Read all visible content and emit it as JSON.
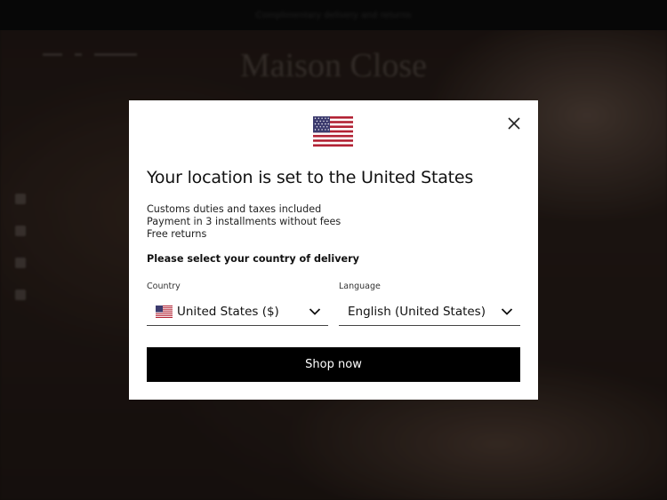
{
  "background": {
    "announcement": "Complimentary delivery and returns",
    "logo": "Maison Close"
  },
  "modal": {
    "flag_icon": "us-flag-icon",
    "close_icon": "close-icon",
    "title": "Your location is set to the United States",
    "benefits": [
      "Customs duties and taxes included",
      "Payment in 3 installments without fees",
      "Free returns"
    ],
    "select_prompt": "Please select your country of delivery",
    "country": {
      "label": "Country",
      "value": "United States ($)"
    },
    "language": {
      "label": "Language",
      "value": "English (United States)"
    },
    "shop_button": "Shop now"
  },
  "colors": {
    "button_bg": "#000000",
    "modal_bg": "#ffffff",
    "overlay": "rgba(0,0,0,0.35)"
  }
}
